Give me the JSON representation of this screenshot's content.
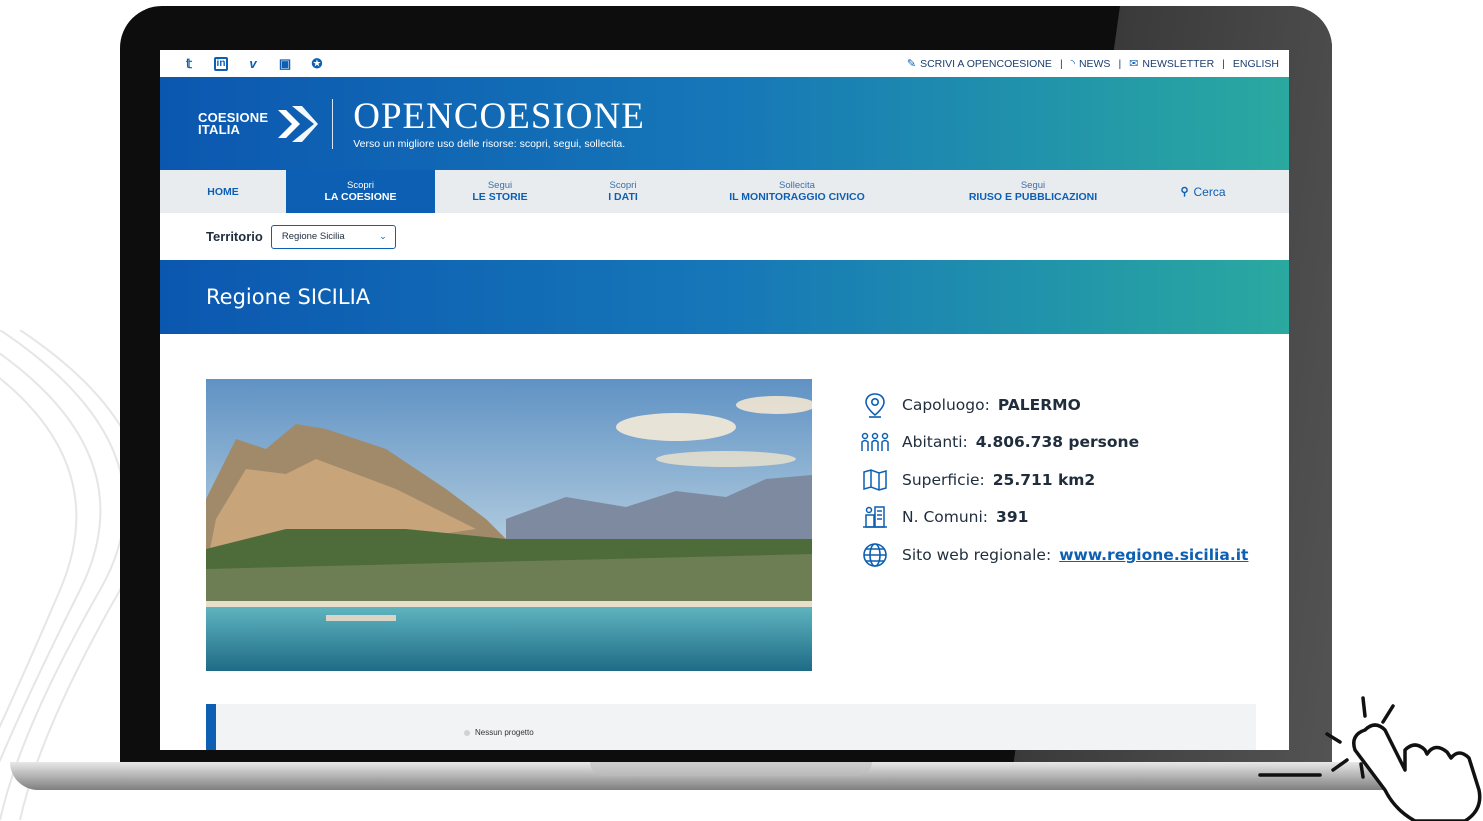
{
  "social": [
    "twitter-icon",
    "linkedin-icon",
    "vimeo-icon",
    "flickr-icon",
    "bookmark-icon"
  ],
  "utility": {
    "write": "SCRIVI A OPENCOESIONE",
    "news": "NEWS",
    "newsletter": "NEWSLETTER",
    "english": "ENGLISH",
    "separator": "|"
  },
  "header": {
    "logo_line1": "COESIONE",
    "logo_line2": "ITALIA",
    "title": "OPENCOESIONE",
    "subtitle": "Verso un migliore uso delle risorse: scopri, segui, sollecita."
  },
  "nav": {
    "home": "HOME",
    "items": [
      {
        "small": "Scopri",
        "big": "LA COESIONE"
      },
      {
        "small": "Segui",
        "big": "LE STORIE"
      },
      {
        "small": "Scopri",
        "big": "I DATI"
      },
      {
        "small": "Sollecita",
        "big": "IL MONITORAGGIO CIVICO"
      },
      {
        "small": "Segui",
        "big": "RIUSO E PUBBLICAZIONI"
      }
    ],
    "search": "Cerca"
  },
  "territory": {
    "label": "Territorio",
    "selected": "Regione Sicilia"
  },
  "region": {
    "title": "Regione SICILIA"
  },
  "facts": {
    "capoluogo_label": "Capoluogo:",
    "capoluogo_value": "PALERMO",
    "abitanti_label": "Abitanti:",
    "abitanti_value": "4.806.738 persone",
    "superficie_label": "Superficie:",
    "superficie_value": "25.711 km2",
    "comuni_label": "N. Comuni:",
    "comuni_value": "391",
    "sito_label": "Sito web regionale:",
    "sito_value": "www.regione.sicilia.it"
  },
  "bottom": {
    "no_project": "Nessun progetto"
  },
  "colors": {
    "brand_blue": "#0d5fb3",
    "gradient_start": "#0b57b0",
    "gradient_end": "#2aa9a0"
  }
}
